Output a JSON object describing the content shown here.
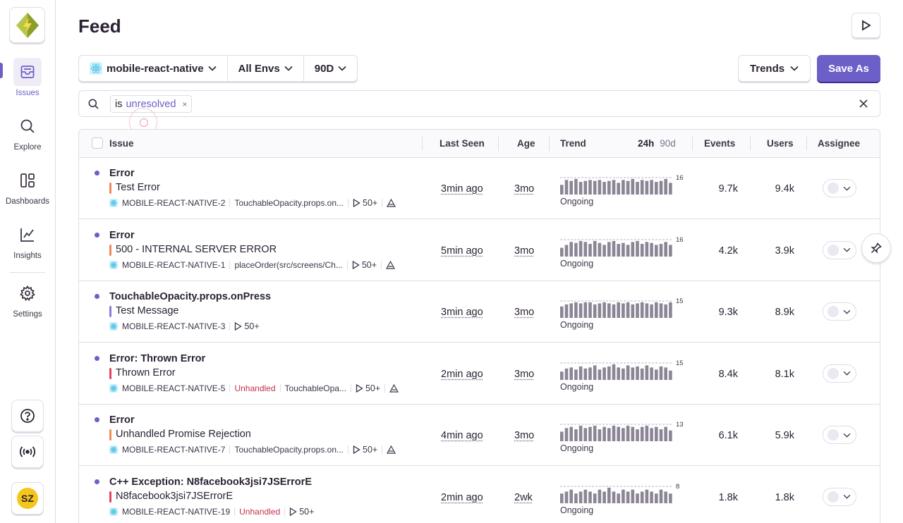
{
  "sidebar": {
    "nav": [
      {
        "label": "Issues",
        "icon": "inbox-icon",
        "active": true
      },
      {
        "label": "Explore",
        "icon": "search-icon",
        "active": false
      },
      {
        "label": "Dashboards",
        "icon": "dashboards-icon",
        "active": false
      },
      {
        "label": "Insights",
        "icon": "chart-icon",
        "active": false
      },
      {
        "label": "Settings",
        "icon": "gear-icon",
        "active": false
      }
    ],
    "avatar_initials": "SZ"
  },
  "header": {
    "title": "Feed"
  },
  "filters": {
    "project": "mobile-react-native",
    "env": "All Envs",
    "period": "90D",
    "trends": "Trends",
    "save_as": "Save As"
  },
  "search": {
    "token_key": "is",
    "token_value": "unresolved",
    "token_remove": "×"
  },
  "table": {
    "headers": {
      "issue": "Issue",
      "last_seen": "Last Seen",
      "age": "Age",
      "trend": "Trend",
      "trend_24h": "24h",
      "trend_90d": "90d",
      "events": "Events",
      "users": "Users",
      "assignee": "Assignee"
    },
    "rows": [
      {
        "title": "Error",
        "message": "Test Error",
        "level_color": "#f1885a",
        "short_id": "MOBILE-REACT-NATIVE-2",
        "unhandled": "",
        "culprit": "TouchableOpacity.props.on...",
        "count": "50+",
        "last_seen": "3min ago",
        "age": "3mo",
        "trend_max": "16",
        "status": "Ongoing",
        "events": "9.7k",
        "users": "9.4k",
        "bars": [
          10,
          15,
          14,
          16,
          13,
          14,
          15,
          14,
          15,
          13,
          14,
          15,
          12,
          15,
          14,
          16,
          13,
          15,
          14,
          15,
          13,
          14,
          16,
          12
        ]
      },
      {
        "title": "Error",
        "message": "500 - INTERNAL SERVER ERROR",
        "level_color": "#f1885a",
        "short_id": "MOBILE-REACT-NATIVE-1",
        "unhandled": "",
        "culprit": "placeOrder(src/screens/Ch...",
        "count": "50+",
        "last_seen": "5min ago",
        "age": "3mo",
        "trend_max": "16",
        "status": "Ongoing",
        "events": "4.2k",
        "users": "3.9k",
        "bars": [
          9,
          12,
          15,
          14,
          16,
          15,
          13,
          16,
          14,
          12,
          15,
          16,
          13,
          14,
          12,
          15,
          16,
          13,
          15,
          14,
          12,
          13,
          15,
          12
        ]
      },
      {
        "title": "TouchableOpacity.props.onPress",
        "message": "Test Message",
        "level_color": "#8e7ad6",
        "short_id": "MOBILE-REACT-NATIVE-3",
        "unhandled": "",
        "culprit": "",
        "count": "50+",
        "last_seen": "3min ago",
        "age": "3mo",
        "trend_max": "15",
        "status": "Ongoing",
        "events": "9.3k",
        "users": "8.9k",
        "bars": [
          11,
          13,
          14,
          15,
          14,
          15,
          15,
          13,
          14,
          15,
          14,
          13,
          15,
          14,
          15,
          13,
          14,
          15,
          14,
          13,
          15,
          14,
          13,
          15
        ]
      },
      {
        "title": "Error: Thrown Error",
        "message": "Thrown Error",
        "level_color": "#e5415f",
        "short_id": "MOBILE-REACT-NATIVE-5",
        "unhandled": "Unhandled",
        "culprit": "TouchableOpa...",
        "count": "50+",
        "last_seen": "2min ago",
        "age": "3mo",
        "trend_max": "15",
        "status": "Ongoing",
        "events": "8.4k",
        "users": "8.1k",
        "bars": [
          8,
          11,
          12,
          10,
          13,
          11,
          12,
          14,
          10,
          12,
          13,
          15,
          12,
          11,
          14,
          12,
          13,
          11,
          14,
          12,
          10,
          13,
          12,
          9
        ]
      },
      {
        "title": "Error",
        "message": "Unhandled Promise Rejection",
        "level_color": "#f1885a",
        "short_id": "MOBILE-REACT-NATIVE-7",
        "unhandled": "",
        "culprit": "TouchableOpacity.props.on...",
        "count": "50+",
        "last_seen": "4min ago",
        "age": "3mo",
        "trend_max": "13",
        "status": "Ongoing",
        "events": "6.1k",
        "users": "5.9k",
        "bars": [
          8,
          11,
          12,
          10,
          13,
          11,
          12,
          13,
          10,
          12,
          11,
          13,
          12,
          11,
          13,
          12,
          10,
          12,
          13,
          11,
          12,
          10,
          12,
          9
        ]
      },
      {
        "title": "C++ Exception: N8facebook3jsi7JSErrorE",
        "message": "N8facebook3jsi7JSErrorE",
        "level_color": "#e5415f",
        "short_id": "MOBILE-REACT-NATIVE-19",
        "unhandled": "Unhandled",
        "culprit": "",
        "count": "50+",
        "last_seen": "2min ago",
        "age": "2wk",
        "trend_max": "8",
        "status": "Ongoing",
        "events": "1.8k",
        "users": "1.8k",
        "bars": [
          5,
          6,
          7,
          5,
          6,
          7,
          6,
          5,
          7,
          6,
          8,
          6,
          5,
          7,
          6,
          7,
          5,
          6,
          7,
          6,
          5,
          7,
          6,
          5
        ]
      }
    ]
  }
}
